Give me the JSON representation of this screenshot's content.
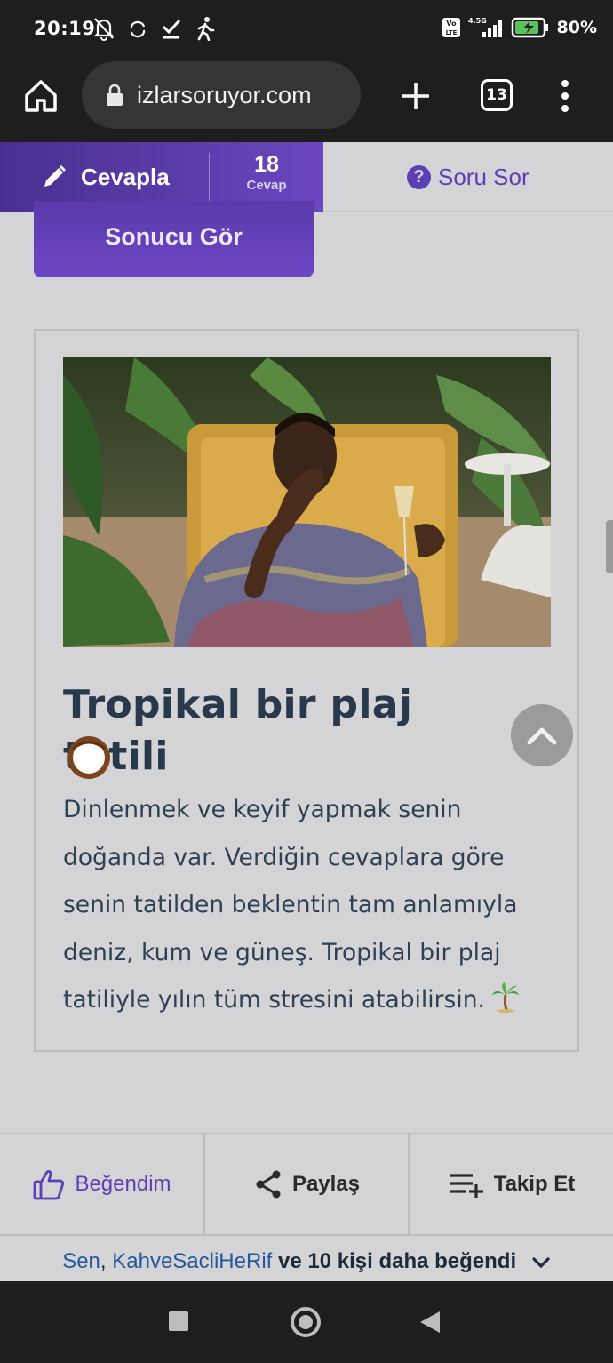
{
  "status_bar": {
    "time": "20:19",
    "battery": "80%",
    "network": "4.5G",
    "volte": "Vo LTE"
  },
  "browser": {
    "url": "izlarsoruyor.com",
    "tab_count": "13"
  },
  "answer_bar": {
    "answer_label": "Cevapla",
    "answer_count": "18",
    "answer_unit": "Cevap",
    "ask_label": "Soru Sor"
  },
  "result_button": {
    "label": "Sonucu Gör"
  },
  "result": {
    "title": "Tropikal bir plaj tatili",
    "title_emoji": "coconut-icon",
    "description": "Dinlenmek ve keyif yapmak senin doğanda var. Verdiğin cevaplara göre senin tatilden beklentin tam anlamıyla deniz, kum ve güneş. Tropikal bir plaj tatiliyle yılın tüm stresini atabilirsin.",
    "description_emoji": "palm-tree-icon"
  },
  "actions": {
    "like": "Beğendim",
    "share": "Paylaş",
    "follow": "Takip Et"
  },
  "likes_line": {
    "you": "Sen",
    "comma": ",",
    "user": "KahveSacliHeRif",
    "and": "ve",
    "count": "10 kişi daha",
    "liked": "beğendi"
  },
  "colors": {
    "accent": "#5b3fb5",
    "title": "#27394b",
    "link": "#25599c",
    "page_bg": "#d4d4d6",
    "system_bar": "#1e1e1f"
  }
}
